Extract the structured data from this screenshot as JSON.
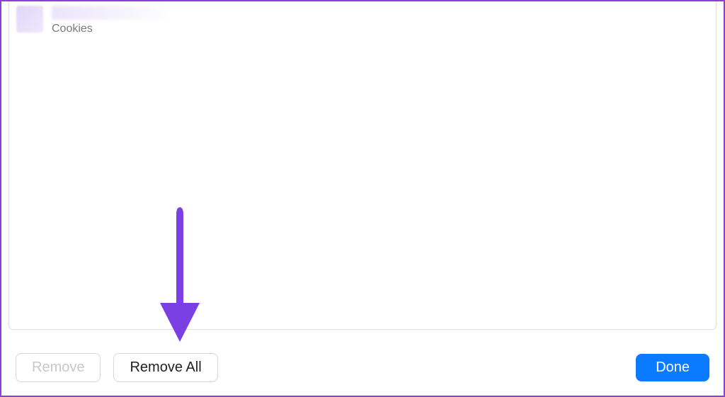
{
  "list": {
    "items": [
      {
        "data_type_label": "Cookies"
      }
    ]
  },
  "buttons": {
    "remove_label": "Remove",
    "remove_all_label": "Remove All",
    "done_label": "Done"
  },
  "colors": {
    "accent": "#0a7aff",
    "annotation": "#7b3fe4"
  }
}
